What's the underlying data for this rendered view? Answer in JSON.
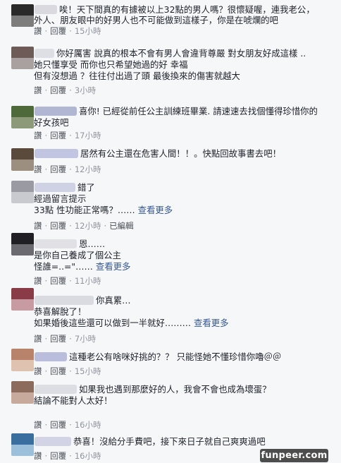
{
  "reply_label": "讚",
  "comment_label": "回覆",
  "edited_label": "已編輯",
  "see_more_label": "查看更多",
  "comments": [
    {
      "lines": [
        "唉！天下間真的有據被以上32點的男人嗎？很懷疑喔，連我老公，",
        "外人、朋友眼中的好男人也不可能做到這樣子，你是在唬爛的吧"
      ],
      "time": "15小時",
      "avatar_colors": [
        "#2a2a2a",
        "#7d7d7d"
      ],
      "name_color": "#cfcfd6"
    },
    {
      "lines": [
        "你好厲害 說真的根本不會有男人會違背尊嚴 對女朋友好成這樣 ..",
        "她只懂享受 而你也只希望她過的好 幸福",
        "但有沒想過 ？往往付出過了頭 最後換來的傷害就越大"
      ],
      "time": "3小時",
      "avatar_colors": [
        "#6e5a57",
        "#a9a19f"
      ],
      "name_color": "#d6d6de"
    },
    {
      "lines": [
        "喜你! 已經從前任公主訓練班畢業. 請速速去找個懂得珍惜你的",
        "好女孩吧"
      ],
      "time": "17小時",
      "avatar_colors": [
        "#4e6a3b",
        "#8c9a7a"
      ],
      "name_color": "#9aa0c4"
    },
    {
      "lines": [
        "居然有公主還在危害人間！！。快點回故事書去吧！"
      ],
      "time": "12小時",
      "avatar_colors": [
        "#5a4a3c",
        "#9c8f80"
      ],
      "name_color": "#b0b4d8"
    },
    {
      "lines": [
        "錯了",
        "經過留言提示",
        "33點 性功能正常嗎？……"
      ],
      "see_more": true,
      "time": "12小時",
      "edited": true,
      "avatar_colors": [
        "#9a9aa2",
        "#c9c9d0"
      ],
      "name_color": "#c2c4dc"
    },
    {
      "lines": [
        "恩……",
        "是你自己養成了個公主",
        "怪誰=..=\"……"
      ],
      "see_more": true,
      "time": "11小時",
      "avatar_colors": [
        "#1f1f24",
        "#6a6a70"
      ],
      "name_color": "#d8d8de"
    },
    {
      "lines": [
        "你真累…",
        "恭喜解脫了！",
        "如果婚後這些還可以做到一半就好………"
      ],
      "see_more": true,
      "time": "7小時",
      "avatar_colors": [
        "#8a3c46",
        "#c89aa2"
      ],
      "name_color": "#d0d0d8"
    },
    {
      "lines": [
        "這種老公有啥咪好挑的？？      只能怪她不懂珍惜你嚕＠＠"
      ],
      "time": "15小時",
      "avatar_colors": [
        "#b9826a",
        "#e0c2b0"
      ],
      "name_color": "#a6aad2"
    },
    {
      "lines": [
        "如果我也遇到那麼好的人，我會不會也成為壞蛋？",
        "結論不能對人太好！"
      ],
      "time": "16小時",
      "avatar_colors": [
        "#8c6a5c",
        "#c7aa9c"
      ],
      "name_color": "#d4d4dc"
    },
    {
      "lines": [
        "恭喜！沒給分手費吧，接下來日子就自己爽爽過吧"
      ],
      "time": "16小時",
      "avatar_colors": [
        "#3a6e9e",
        "#9cc0dc"
      ],
      "name_color": "#c6c8de"
    }
  ],
  "watermark": "funpeer.com"
}
